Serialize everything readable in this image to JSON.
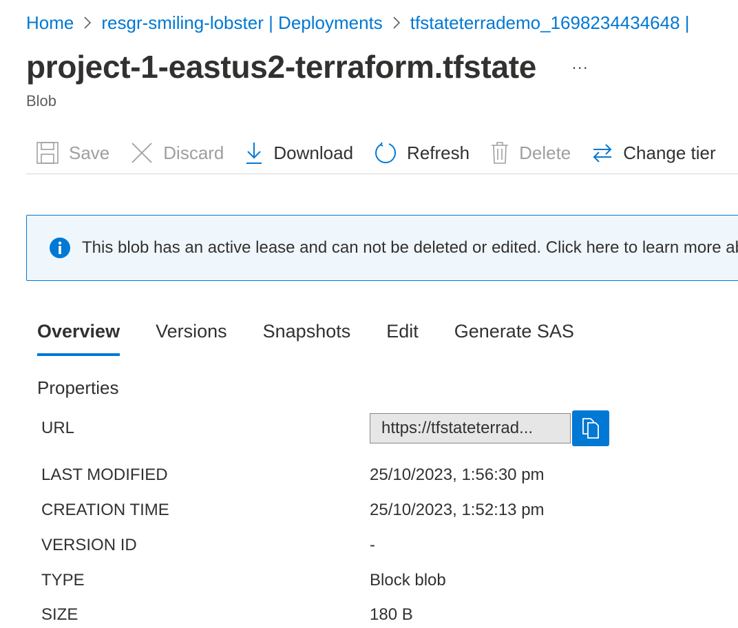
{
  "breadcrumb": {
    "home": "Home",
    "deployments": "resgr-smiling-lobster | Deployments",
    "deployment": "tfstateterrademo_1698234434648 |"
  },
  "header": {
    "title": "project-1-eastus2-terraform.tfstate",
    "more": "...",
    "subtitle": "Blob"
  },
  "toolbar": {
    "save": "Save",
    "discard": "Discard",
    "download": "Download",
    "refresh": "Refresh",
    "delete": "Delete",
    "change_tier": "Change tier"
  },
  "banner": {
    "text": "This blob has an active lease and can not be deleted or edited. Click here to learn more about leases."
  },
  "tabs": [
    "Overview",
    "Versions",
    "Snapshots",
    "Edit",
    "Generate SAS"
  ],
  "properties": {
    "heading": "Properties",
    "url_label": "URL",
    "url_value": "https://tfstateterrad...",
    "last_modified_label": "LAST MODIFIED",
    "last_modified_value": "25/10/2023, 1:56:30 pm",
    "creation_time_label": "CREATION TIME",
    "creation_time_value": "25/10/2023, 1:52:13 pm",
    "version_id_label": "VERSION ID",
    "version_id_value": "-",
    "type_label": "TYPE",
    "type_value": "Block blob",
    "size_label": "SIZE",
    "size_value": "180 B"
  },
  "colors": {
    "accent": "#0078d4",
    "banner_bg": "#eff6fc",
    "disabled_text": "#a19f9d"
  }
}
